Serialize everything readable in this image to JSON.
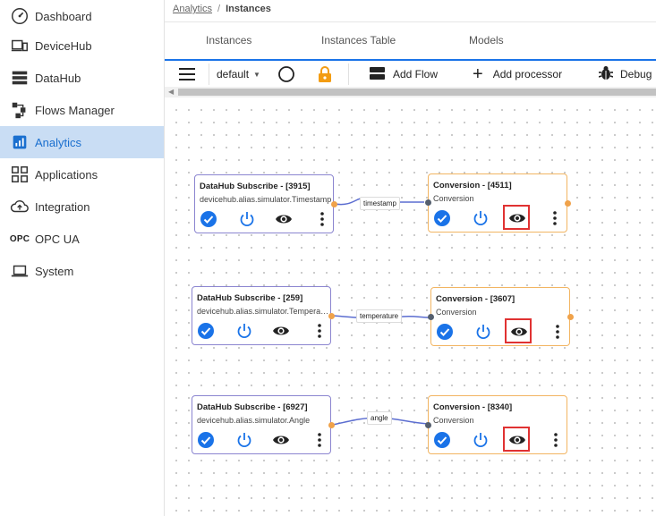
{
  "colors": {
    "accent": "#1a73e8",
    "active_bg": "#c9ddf4",
    "highlight": "#e03232",
    "lock": "#f39c12"
  },
  "sidebar": {
    "items": [
      {
        "label": "Dashboard",
        "icon": "speedometer-icon"
      },
      {
        "label": "DeviceHub",
        "icon": "devices-icon"
      },
      {
        "label": "DataHub",
        "icon": "database-icon"
      },
      {
        "label": "Flows Manager",
        "icon": "flow-icon"
      },
      {
        "label": "Analytics",
        "icon": "analytics-icon",
        "active": true
      },
      {
        "label": "Applications",
        "icon": "apps-grid-icon"
      },
      {
        "label": "Integration",
        "icon": "cloud-upload-icon"
      },
      {
        "label": "OPC UA",
        "icon": "opc-icon",
        "icon_text": "OPC"
      },
      {
        "label": "System",
        "icon": "laptop-icon"
      }
    ]
  },
  "breadcrumb": {
    "parent": "Analytics",
    "separator": "/",
    "current": "Instances"
  },
  "tabs": [
    "Instances",
    "Instances Table",
    "Models"
  ],
  "toolbar": {
    "flow_select": "default",
    "add_flow": "Add Flow",
    "add_processor": "Add processor",
    "debug": "Debug"
  },
  "flows": [
    {
      "source": {
        "title": "DataHub Subscribe - [3915]",
        "subtitle": "devicehub.alias.simulator.Timestamp"
      },
      "link_label": "timestamp",
      "target": {
        "title": "Conversion - [4511]",
        "subtitle": "Conversion"
      }
    },
    {
      "source": {
        "title": "DataHub Subscribe - [259]",
        "subtitle": "devicehub.alias.simulator.Temperature"
      },
      "link_label": "temperature",
      "target": {
        "title": "Conversion - [3607]",
        "subtitle": "Conversion"
      }
    },
    {
      "source": {
        "title": "DataHub Subscribe - [6927]",
        "subtitle": "devicehub.alias.simulator.Angle"
      },
      "link_label": "angle",
      "target": {
        "title": "Conversion - [8340]",
        "subtitle": "Conversion"
      }
    }
  ]
}
